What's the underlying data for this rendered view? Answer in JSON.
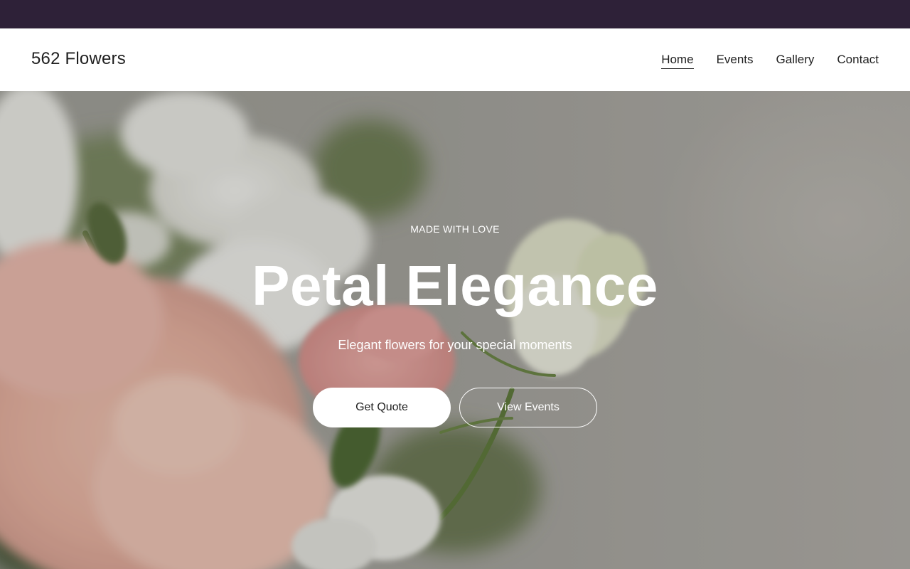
{
  "brand": {
    "name": "562 Flowers"
  },
  "nav": {
    "items": [
      {
        "label": "Home",
        "active": true
      },
      {
        "label": "Events",
        "active": false
      },
      {
        "label": "Gallery",
        "active": false
      },
      {
        "label": "Contact",
        "active": false
      }
    ]
  },
  "hero": {
    "eyebrow": "MADE WITH LOVE",
    "title": "Petal Elegance",
    "subtitle": "Elegant flowers for your special moments",
    "primary_button": "Get Quote",
    "secondary_button": "View Events"
  },
  "colors": {
    "topbar": "#2e2138",
    "header_bg": "#ffffff",
    "text_dark": "#1f1f1f",
    "hero_text": "#ffffff"
  }
}
